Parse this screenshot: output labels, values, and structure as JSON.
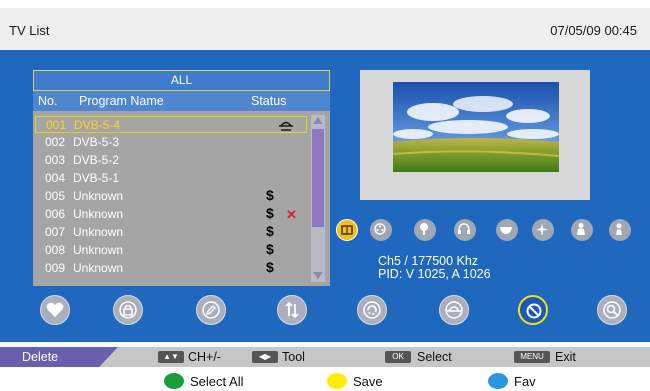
{
  "header": {
    "title": "TV List",
    "datetime": "07/05/09 00:45"
  },
  "list": {
    "group": "ALL",
    "columns": {
      "no": "No.",
      "name": "Program Name",
      "status": "Status"
    },
    "rows": [
      {
        "no": "001",
        "name": "DVB-5-4",
        "dollar": "",
        "x": ""
      },
      {
        "no": "002",
        "name": "DVB-5-3",
        "dollar": "",
        "x": ""
      },
      {
        "no": "003",
        "name": "DVB-5-2",
        "dollar": "",
        "x": ""
      },
      {
        "no": "004",
        "name": "DVB-5-1",
        "dollar": "",
        "x": ""
      },
      {
        "no": "005",
        "name": "Unknown",
        "dollar": "$",
        "x": ""
      },
      {
        "no": "006",
        "name": "Unknown",
        "dollar": "$",
        "x": "✕"
      },
      {
        "no": "007",
        "name": "Unknown",
        "dollar": "$",
        "x": ""
      },
      {
        "no": "008",
        "name": "Unknown",
        "dollar": "$",
        "x": ""
      },
      {
        "no": "009",
        "name": "Unknown",
        "dollar": "$",
        "x": ""
      }
    ],
    "selected_index": 0,
    "row0_status_icon": "skip-icon"
  },
  "info": {
    "line1": "Ch5 / 177500  Khz",
    "line2": "PID: V 1025, A 1026"
  },
  "categories": [
    "tv-icon",
    "film-icon",
    "news-icon",
    "music-icon",
    "food-icon",
    "travel-icon",
    "person-icon",
    "kids-icon"
  ],
  "functions": [
    "favorite-icon",
    "lock-icon",
    "edit-icon",
    "move-icon",
    "sort-icon",
    "skip-icon",
    "delete-icon",
    "find-icon"
  ],
  "help": {
    "delete": "Delete",
    "ch_key": "▲▼",
    "ch_label": "CH+/-",
    "tool_key": "◀▶",
    "tool_label": "Tool",
    "ok_key": "OK",
    "ok_label": "Select",
    "menu_key": "MENU",
    "menu_label": "Exit"
  },
  "colors": {
    "green_label": "Select  All",
    "yellow_label": "Save",
    "blue_label": "Fav",
    "green": "#1a9d3a",
    "yellow": "#ffee00",
    "blue": "#2a97dc"
  }
}
